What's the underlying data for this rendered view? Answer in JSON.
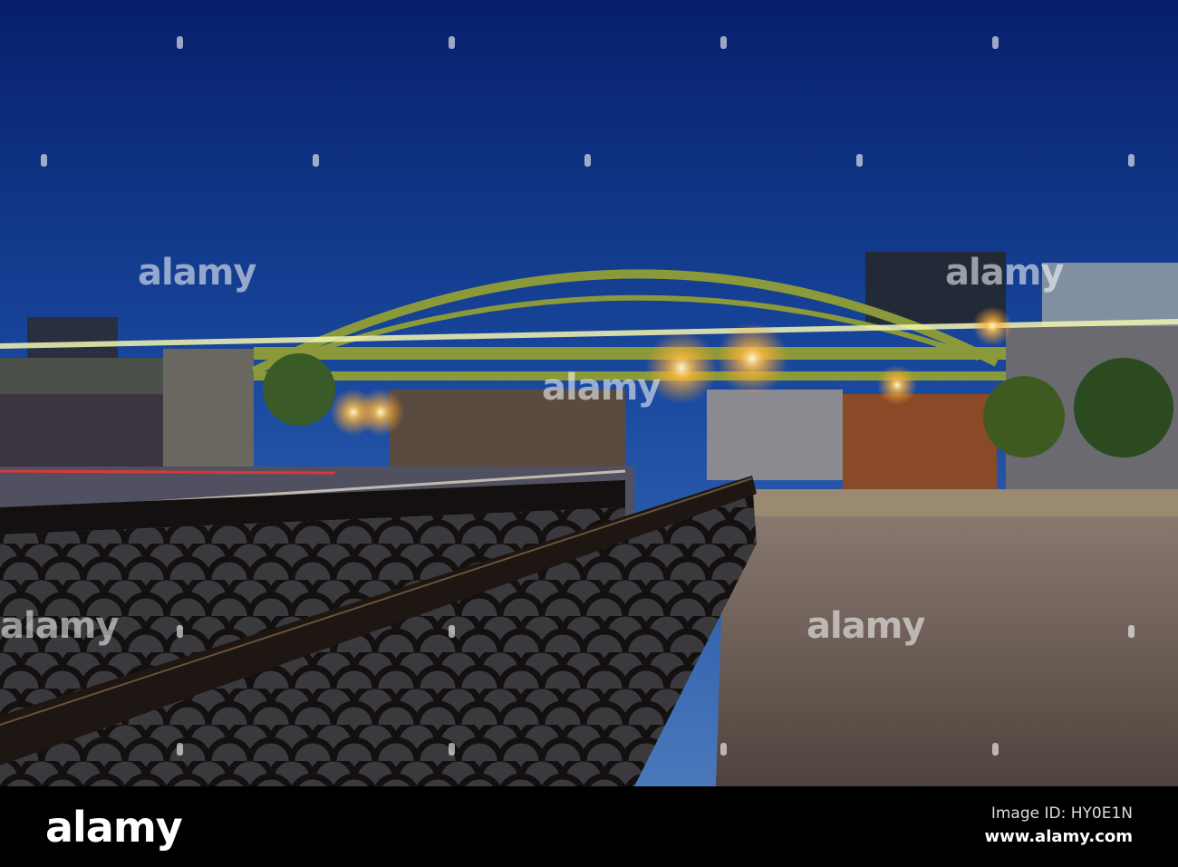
{
  "watermark": "alamy",
  "footer": {
    "logo": "alamy",
    "image_id": "Image ID: HY0E1N",
    "website": "www.alamy.com"
  },
  "colors": {
    "sky_top": "#0a2a7a",
    "sky_bottom": "#3f6fb8",
    "bridge": "#8a9a3a",
    "railing": "#1a1412",
    "pavement": "#6b5d55"
  }
}
